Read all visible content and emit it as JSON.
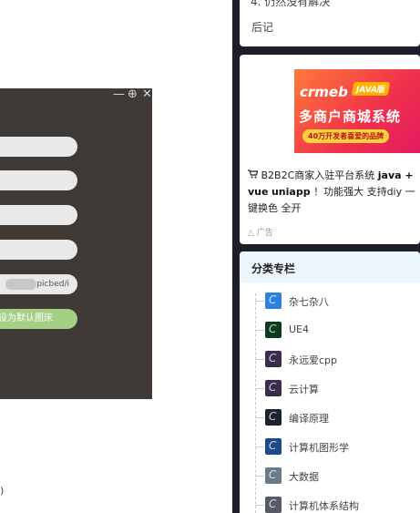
{
  "dialog": {
    "controls": {
      "minimize": "—",
      "maximize": "⊕",
      "close": "✕"
    },
    "last_field_value": "picbed/i",
    "default_button_label": "设为默认图床"
  },
  "stray_char": ")",
  "top_card": {
    "line1": "4. 仍然没有解决",
    "line2": "后记"
  },
  "ad": {
    "brand": "crmeb",
    "tag": "JAVA版",
    "headline": "多商户商城系统",
    "tagline": "40万开发者喜爱的品牌",
    "text_part1": "B2B2C商家入驻平台系统",
    "text_bold1": "java + vue",
    "text_bold2": "uniapp",
    "text_part2": "！功能强大 支持diy 一键换色 全开",
    "footer": "广告",
    "colors": {
      "banner_start": "#ff7a3a",
      "banner_end": "#e21863",
      "tag": "#ffb300"
    }
  },
  "categories": {
    "title": "分类专栏",
    "items": [
      {
        "label": "杂七杂八",
        "color": "#2d7fe0"
      },
      {
        "label": "UE4",
        "color": "#0d3b1c"
      },
      {
        "label": "永远爱cpp",
        "color": "#3a2c4a"
      },
      {
        "label": "云计算",
        "color": "#3a2c4a"
      },
      {
        "label": "编译原理",
        "color": "#1c2330"
      },
      {
        "label": "计算机图形学",
        "color": "#1f4a8a"
      },
      {
        "label": "大数据",
        "color": "#6a7a88"
      },
      {
        "label": "计算机体系结构",
        "color": "#555a66"
      }
    ]
  }
}
